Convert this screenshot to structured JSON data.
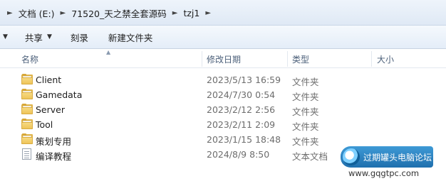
{
  "breadcrumb": {
    "items": [
      "文档 (E:)",
      "71520_天之禁全套源码",
      "tzj1"
    ]
  },
  "toolbar": {
    "share_label": "共享",
    "burn_label": "刻录",
    "new_folder_label": "新建文件夹"
  },
  "columns": {
    "name": "名称",
    "modified": "修改日期",
    "type": "类型",
    "size": "大小"
  },
  "files": [
    {
      "name": "Client",
      "modified": "2023/5/13 16:59",
      "type": "文件夹",
      "icon": "folder-icon"
    },
    {
      "name": "Gamedata",
      "modified": "2024/7/30 0:54",
      "type": "文件夹",
      "icon": "folder-icon"
    },
    {
      "name": "Server",
      "modified": "2023/2/12 2:56",
      "type": "文件夹",
      "icon": "folder-icon"
    },
    {
      "name": "Tool",
      "modified": "2023/2/11 2:09",
      "type": "文件夹",
      "icon": "folder-icon"
    },
    {
      "name": "策划专用",
      "modified": "2023/1/15 18:48",
      "type": "文件夹",
      "icon": "folder-icon"
    },
    {
      "name": "编译教程",
      "modified": "2024/8/9 8:50",
      "type": "文本文档",
      "icon": "text-file-icon"
    }
  ],
  "watermark": {
    "title": "过期罐头电脑论坛",
    "url": "www.gqgtpc.com"
  },
  "colors": {
    "folder": "#eec45a",
    "header_text": "#4c607a",
    "meta_text": "#6d6d6d",
    "watermark_blue": "#1f6fad"
  }
}
